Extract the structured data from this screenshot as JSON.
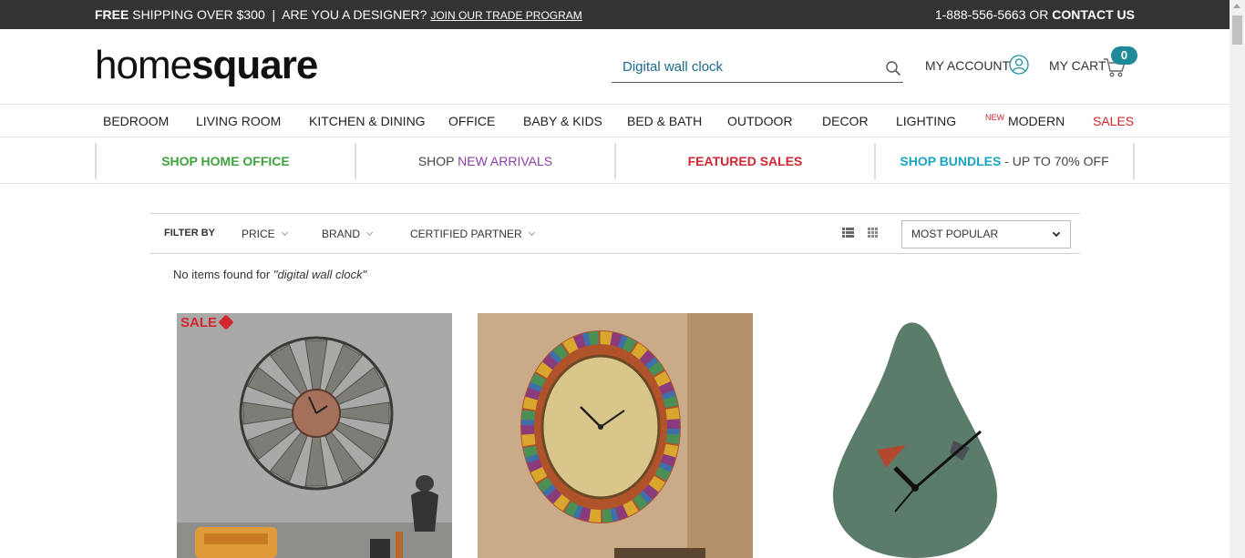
{
  "topbar": {
    "free": "FREE",
    "shipping": " SHIPPING OVER $300",
    "sep": "|",
    "designer": "ARE YOU A DESIGNER?",
    "trade_link": "JOIN OUR TRADE PROGRAM",
    "phone": "1-888-556-5663 OR",
    "contact": "CONTACT US"
  },
  "header": {
    "logo_home": "home",
    "logo_square": "square",
    "search_value": "Digital wall clock",
    "account_label": "MY ACCOUNT",
    "cart_label": "MY CART",
    "cart_count": "0"
  },
  "nav": {
    "items": [
      "BEDROOM",
      "LIVING ROOM",
      "KITCHEN & DINING",
      "OFFICE",
      "BABY & KIDS",
      "BED & BATH",
      "OUTDOOR",
      "DECOR",
      "LIGHTING",
      "MODERN",
      "SALES"
    ],
    "new_tag": "NEW"
  },
  "promos": {
    "home_office": "SHOP HOME OFFICE",
    "new_arrivals_prefix": "SHOP ",
    "new_arrivals": "NEW ARRIVALS",
    "featured": "FEATURED SALES",
    "bundles": "SHOP BUNDLES",
    "bundles_suffix": " - UP TO 70% OFF"
  },
  "filter": {
    "label": "FILTER BY",
    "price": "PRICE",
    "brand": "BRAND",
    "certified": "CERTIFIED PARTNER",
    "sort_selected": "MOST POPULAR"
  },
  "results": {
    "prefix": "No items found for ",
    "query": "\"digital wall clock\""
  },
  "products": [
    {
      "badge": "SALE"
    },
    {},
    {}
  ],
  "colors": {
    "accent_teal": "#1f8b9a",
    "sale_red": "#d22630",
    "topbar_bg": "#333333"
  }
}
